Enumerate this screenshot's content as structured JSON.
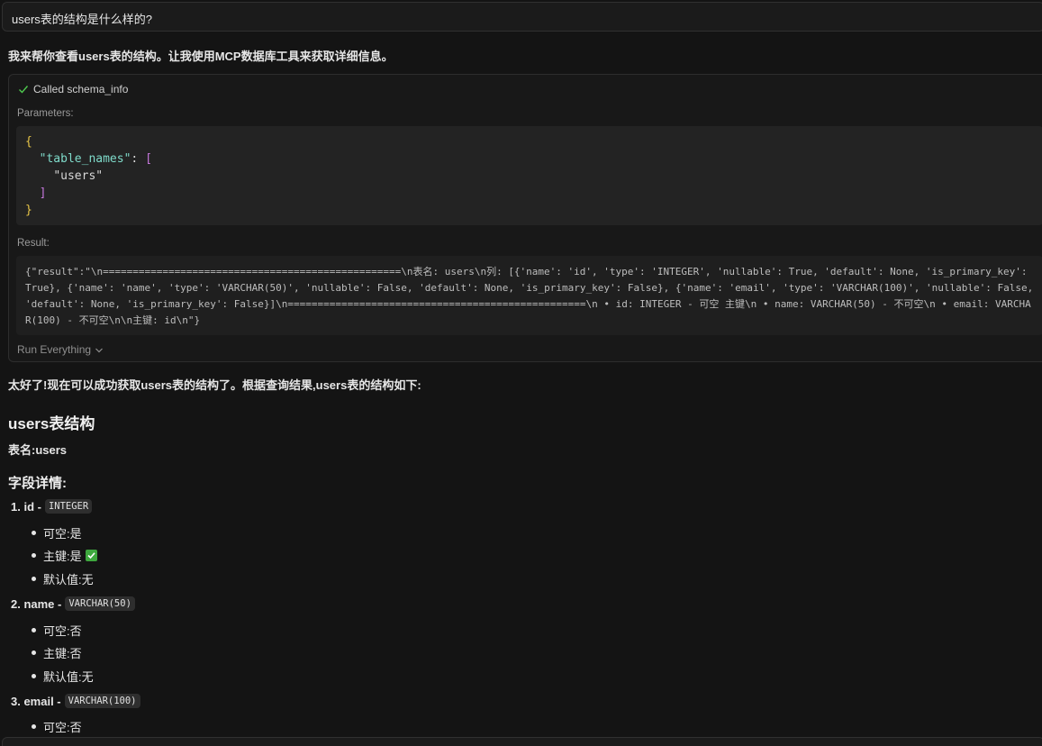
{
  "question": "users表的结构是什么样的?",
  "intro": "我来帮你查看users表的结构。让我使用MCP数据库工具来获取详细信息。",
  "tool_call": {
    "header": "Called schema_info",
    "parameters_label": "Parameters:",
    "params": {
      "open_brace": "{",
      "key": "\"table_names\"",
      "colon": ": ",
      "open_bracket": "[",
      "value": "\"users\"",
      "close_bracket": "]",
      "close_brace": "}"
    },
    "result_label": "Result:",
    "result_text": "{\"result\":\"\\n==================================================\\n表名: users\\n列: [{'name': 'id', 'type': 'INTEGER', 'nullable': True, 'default': None, 'is_primary_key': True}, {'name': 'name', 'type': 'VARCHAR(50)', 'nullable': False, 'default': None, 'is_primary_key': False}, {'name': 'email', 'type': 'VARCHAR(100)', 'nullable': False, 'default': None, 'is_primary_key': False}]\\n==================================================\\n  • id: INTEGER - 可空 主键\\n  • name: VARCHAR(50) - 不可空\\n  • email: VARCHAR(100) - 不可空\\n\\n主键: id\\n\"}",
    "run_everything": "Run Everything"
  },
  "summary": "太好了!现在可以成功获取users表的结构了。根据查询结果,users表的结构如下:",
  "heading": "users表结构",
  "table_name_line": "表名:users",
  "fields_heading": "字段详情:",
  "fields": [
    {
      "title": "1. id - ",
      "type": "INTEGER",
      "bullets": [
        "可空:是",
        "主键:是",
        "默认值:无"
      ]
    },
    {
      "title": "2. name - ",
      "type": "VARCHAR(50)",
      "bullets": [
        "可空:否",
        "主键:否",
        "默认值:无"
      ]
    },
    {
      "title": "3. email - ",
      "type": "VARCHAR(100)",
      "bullets": [
        "可空:否"
      ]
    }
  ],
  "colors": {
    "background": "#141414",
    "check_green": "#3ea83e",
    "json_brace": "#e7c547",
    "json_bracket": "#c678dd",
    "json_key": "#7fdbca"
  }
}
